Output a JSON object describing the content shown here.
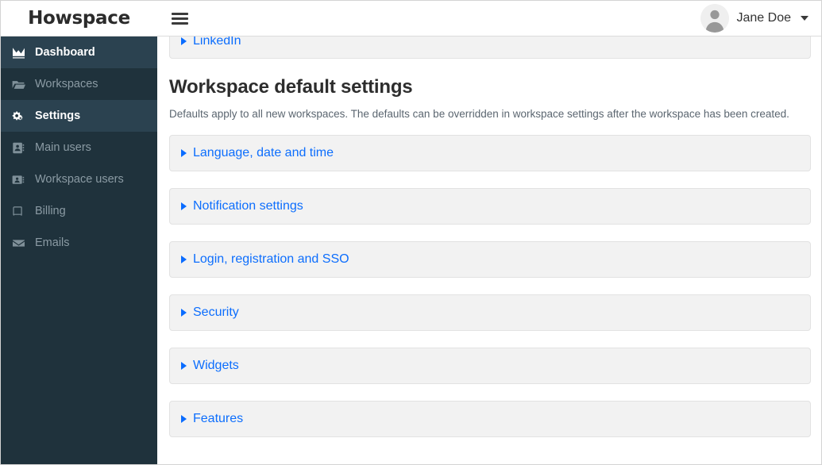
{
  "header": {
    "brand": "Howspace",
    "menu_icon": "hamburger-icon",
    "user": {
      "name": "Jane Doe",
      "avatar_icon": "user-avatar-icon",
      "caret_icon": "chevron-down-icon"
    }
  },
  "sidebar": {
    "items": [
      {
        "label": "Dashboard",
        "icon": "chart-area-icon",
        "active": true
      },
      {
        "label": "Workspaces",
        "icon": "folder-open-icon",
        "active": false
      },
      {
        "label": "Settings",
        "icon": "gears-icon",
        "active": true
      },
      {
        "label": "Main users",
        "icon": "address-book-icon",
        "active": false
      },
      {
        "label": "Workspace users",
        "icon": "address-card-icon",
        "active": false
      },
      {
        "label": "Billing",
        "icon": "book-icon",
        "active": false
      },
      {
        "label": "Emails",
        "icon": "envelope-icon",
        "active": false
      }
    ]
  },
  "main": {
    "top_panel": {
      "label": "LinkedIn",
      "toggle_icon": "triangle-right-icon"
    },
    "section": {
      "title": "Workspace default settings",
      "description": "Defaults apply to all new workspaces. The defaults can be overridden in workspace settings after the workspace has been created."
    },
    "panels": [
      {
        "label": "Language, date and time",
        "toggle_icon": "triangle-right-icon"
      },
      {
        "label": "Notification settings",
        "toggle_icon": "triangle-right-icon"
      },
      {
        "label": "Login, registration and SSO",
        "toggle_icon": "triangle-right-icon"
      },
      {
        "label": "Security",
        "toggle_icon": "triangle-right-icon"
      },
      {
        "label": "Widgets",
        "toggle_icon": "triangle-right-icon"
      },
      {
        "label": "Features",
        "toggle_icon": "triangle-right-icon"
      }
    ]
  },
  "colors": {
    "sidebar_bg": "#1f323c",
    "sidebar_active_bg": "#2b4250",
    "link_blue": "#0d6efd",
    "panel_bg": "#f2f2f2"
  }
}
